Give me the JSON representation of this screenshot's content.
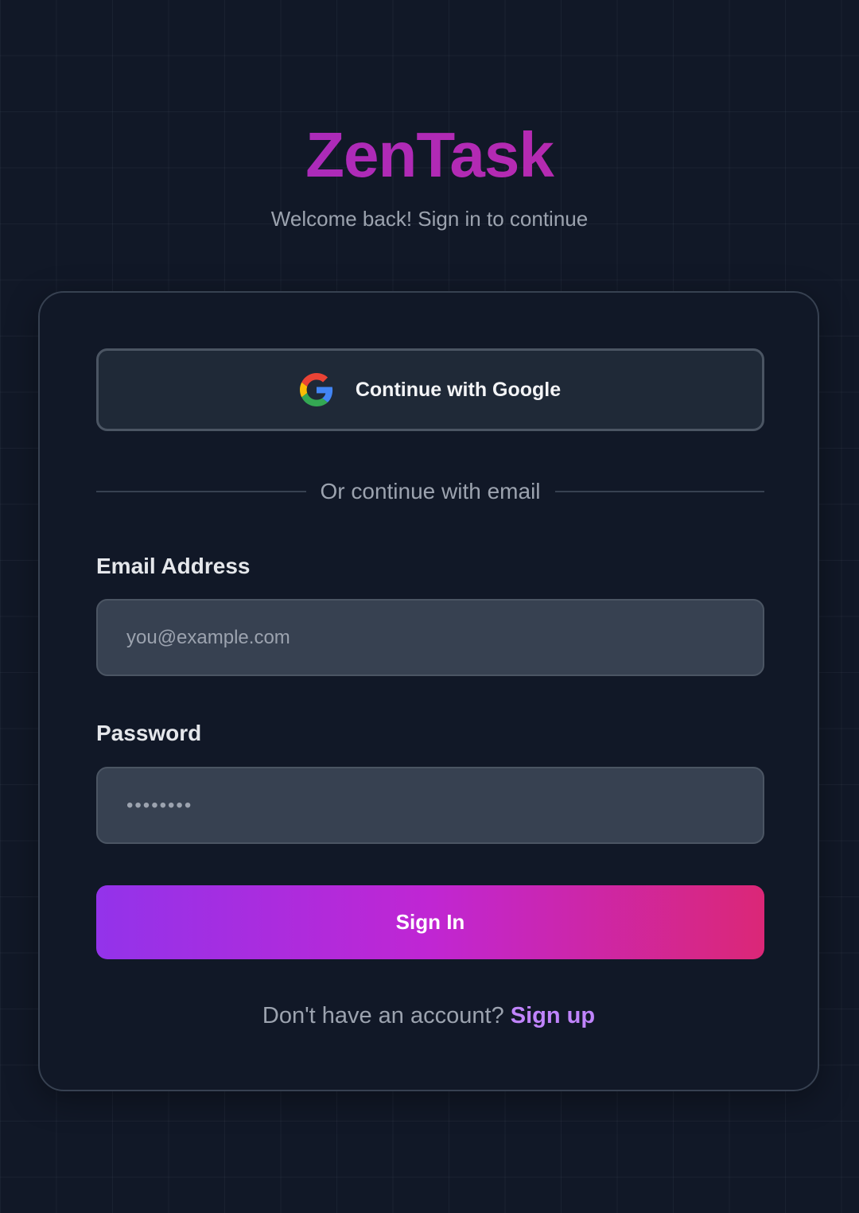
{
  "brand": {
    "name": "ZenTask",
    "tagline": "Welcome back! Sign in to continue"
  },
  "card": {
    "google_button_label": "Continue with Google",
    "divider_text": "Or continue with email",
    "email": {
      "label": "Email Address",
      "placeholder": "you@example.com",
      "value": ""
    },
    "password": {
      "label": "Password",
      "value": "••••••••"
    },
    "signin_label": "Sign In",
    "footer": {
      "prompt": "Don't have an account?",
      "link_label": "Sign up"
    }
  },
  "icons": {
    "google": "google-icon"
  },
  "colors": {
    "background": "#111827",
    "brand_gradient_start": "#9333ea",
    "brand_gradient_end": "#db2777",
    "link": "#c084fc"
  }
}
